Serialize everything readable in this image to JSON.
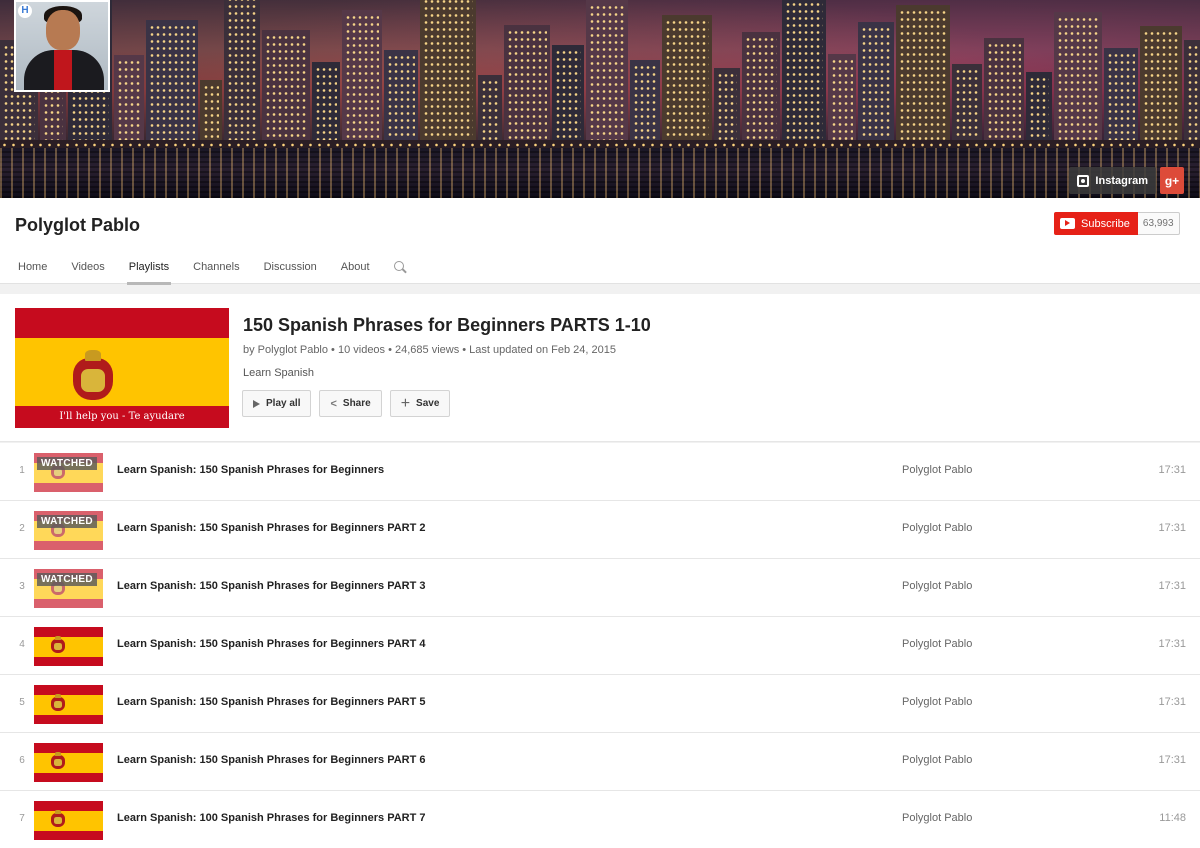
{
  "channel": {
    "name": "Polyglot Pablo",
    "subscribe_label": "Subscribe",
    "subscriber_count": "63,993",
    "social": {
      "instagram": "Instagram",
      "gplus": "g+"
    },
    "avatar_badge": "H"
  },
  "nav": {
    "tabs": [
      "Home",
      "Videos",
      "Playlists",
      "Channels",
      "Discussion",
      "About"
    ],
    "active": "Playlists"
  },
  "playlist": {
    "title": "150 Spanish Phrases for Beginners PARTS 1-10",
    "meta": "by Polyglot Pablo • 10 videos • 24,685 views • Last updated on Feb 24, 2015",
    "description": "Learn Spanish",
    "thumb_caption": "I'll help you - Te ayudare",
    "actions": {
      "play_all": "Play all",
      "share": "Share",
      "save": "Save"
    }
  },
  "videos": [
    {
      "index": "1",
      "title": "Learn Spanish: 150 Spanish Phrases for Beginners",
      "owner": "Polyglot Pablo",
      "duration": "17:31",
      "watched": true,
      "watched_label": "WATCHED"
    },
    {
      "index": "2",
      "title": "Learn Spanish: 150 Spanish Phrases for Beginners PART 2",
      "owner": "Polyglot Pablo",
      "duration": "17:31",
      "watched": true,
      "watched_label": "WATCHED"
    },
    {
      "index": "3",
      "title": "Learn Spanish: 150 Spanish Phrases for Beginners PART 3",
      "owner": "Polyglot Pablo",
      "duration": "17:31",
      "watched": true,
      "watched_label": "WATCHED"
    },
    {
      "index": "4",
      "title": "Learn Spanish: 150 Spanish Phrases for Beginners PART 4",
      "owner": "Polyglot Pablo",
      "duration": "17:31",
      "watched": false
    },
    {
      "index": "5",
      "title": "Learn Spanish: 150 Spanish Phrases for Beginners PART 5",
      "owner": "Polyglot Pablo",
      "duration": "17:31",
      "watched": false
    },
    {
      "index": "6",
      "title": "Learn Spanish: 150 Spanish Phrases for Beginners PART 6",
      "owner": "Polyglot Pablo",
      "duration": "17:31",
      "watched": false
    },
    {
      "index": "7",
      "title": "Learn Spanish: 100 Spanish Phrases for Beginners PART 7",
      "owner": "Polyglot Pablo",
      "duration": "11:48",
      "watched": false
    }
  ],
  "colors": {
    "subscribe_red": "#e62117",
    "flag_red": "#c60b1e",
    "flag_yellow": "#ffc400",
    "gplus_red": "#dd4b39"
  }
}
